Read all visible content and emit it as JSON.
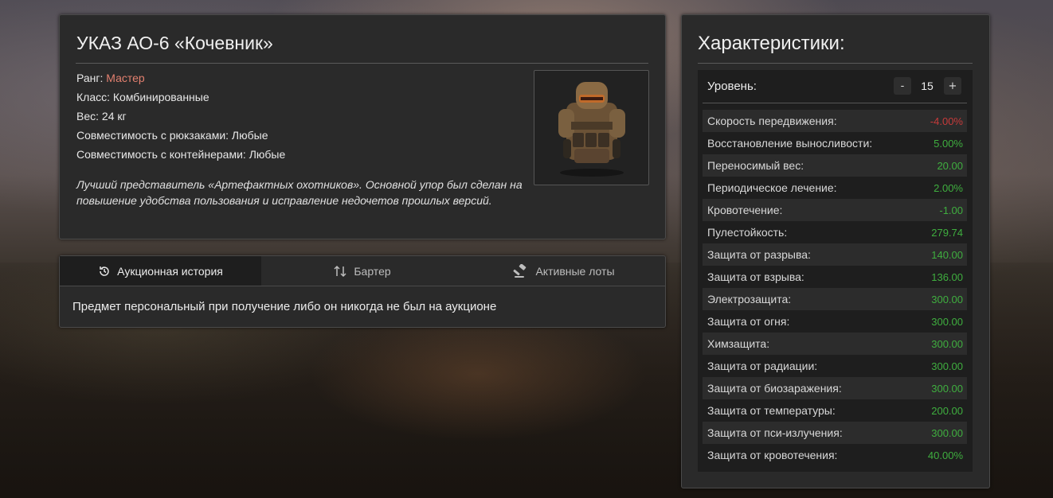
{
  "item": {
    "title": "УКАЗ АО-6 «Кочевник»",
    "rank_label": "Ранг:",
    "rank_value": "Мастер",
    "class_line": "Класс: Комбинированные",
    "weight_line": "Вес: 24 кг",
    "backpack_line": "Совместимость с рюкзаками: Любые",
    "container_line": "Совместимость с контейнерами: Любые",
    "description": "Лучший представитель «Артефактных охотников». Основной упор был сделан на повышение удобства пользования и исправление недочетов прошлых версий.",
    "image_icon": "armor-suit-image"
  },
  "tabs": [
    {
      "label": "Аукционная история",
      "icon": "history-icon",
      "active": true
    },
    {
      "label": "Бартер",
      "icon": "swap-arrows-icon",
      "active": false
    },
    {
      "label": "Активные лоты",
      "icon": "gavel-icon",
      "active": false
    }
  ],
  "history_message": "Предмет персональный при получение либо он никогда не был на аукционе",
  "stats": {
    "title": "Характеристики:",
    "level_label": "Уровень:",
    "level_value": "15",
    "minus_label": "-",
    "plus_label": "+",
    "rows": [
      {
        "name": "Скорость передвижения:",
        "value": "-4.00%",
        "color": "neg"
      },
      {
        "name": "Восстановление выносливости:",
        "value": "5.00%",
        "color": "pos"
      },
      {
        "name": "Переносимый вес:",
        "value": "20.00",
        "color": "pos"
      },
      {
        "name": "Периодическое лечение:",
        "value": "2.00%",
        "color": "pos"
      },
      {
        "name": "Кровотечение:",
        "value": "-1.00",
        "color": "pos"
      },
      {
        "name": "Пулестойкость:",
        "value": "279.74",
        "color": "pos"
      },
      {
        "name": "Защита от разрыва:",
        "value": "140.00",
        "color": "pos"
      },
      {
        "name": "Защита от взрыва:",
        "value": "136.00",
        "color": "pos"
      },
      {
        "name": "Электрозащита:",
        "value": "300.00",
        "color": "pos"
      },
      {
        "name": "Защита от огня:",
        "value": "300.00",
        "color": "pos"
      },
      {
        "name": "Химзащита:",
        "value": "300.00",
        "color": "pos"
      },
      {
        "name": "Защита от радиации:",
        "value": "300.00",
        "color": "pos"
      },
      {
        "name": "Защита от биозаражения:",
        "value": "300.00",
        "color": "pos"
      },
      {
        "name": "Защита от температуры:",
        "value": "200.00",
        "color": "pos"
      },
      {
        "name": "Защита от пси-излучения:",
        "value": "300.00",
        "color": "pos"
      },
      {
        "name": "Защита от кровотечения:",
        "value": "40.00%",
        "color": "pos"
      }
    ]
  },
  "colors": {
    "positive": "#3fae3f",
    "negative": "#c63a3a",
    "rank": "#e3806f",
    "panel": "#2a2a2a"
  }
}
